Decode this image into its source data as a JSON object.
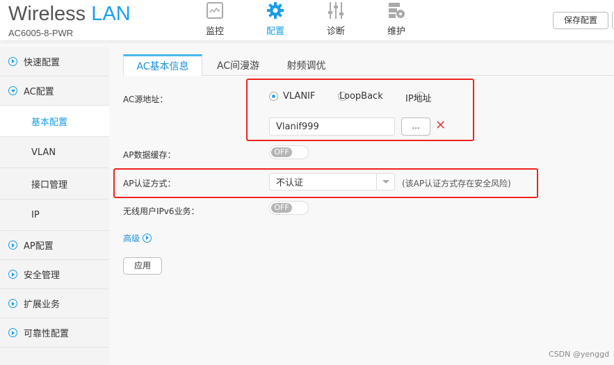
{
  "header": {
    "logo_main": "Wireless",
    "logo_accent": "LAN",
    "model": "AC6005-8-PWR",
    "save_button": "保存配置",
    "nav": [
      {
        "label": "监控",
        "icon": "monitor-icon"
      },
      {
        "label": "配置",
        "icon": "gear-icon",
        "active": true
      },
      {
        "label": "诊断",
        "icon": "sliders-icon"
      },
      {
        "label": "维护",
        "icon": "maintenance-icon"
      }
    ]
  },
  "sidebar": {
    "items": [
      {
        "label": "快速配置"
      },
      {
        "label": "AC配置",
        "expanded": true
      },
      {
        "label": "基本配置",
        "active": true
      },
      {
        "label": "VLAN"
      },
      {
        "label": "接口管理"
      },
      {
        "label": "IP"
      },
      {
        "label": "AP配置"
      },
      {
        "label": "安全管理"
      },
      {
        "label": "扩展业务"
      },
      {
        "label": "可靠性配置"
      }
    ]
  },
  "tabs": [
    {
      "label": "AC基本信息",
      "active": true
    },
    {
      "label": "AC间漫游"
    },
    {
      "label": "射频调优"
    }
  ],
  "form": {
    "source_label": "AC源地址：",
    "radio_options": [
      "VLANIF",
      "LoopBack",
      "IP地址"
    ],
    "radio_selected": "VLANIF",
    "source_value": "Vlanif999",
    "browse_button": "...",
    "cache_label": "AP数据缓存：",
    "cache_state": "OFF",
    "auth_label": "AP认证方式：",
    "auth_value": "不认证",
    "auth_hint": "(该AP认证方式存在安全风险)",
    "ipv6_label": "无线用户IPv6业务：",
    "ipv6_state": "OFF",
    "advanced": "高级",
    "apply_button": "应用"
  },
  "colors": {
    "accent": "#1a9ce8",
    "highlight": "#f0221d"
  },
  "watermark": "CSDN @yenggd"
}
